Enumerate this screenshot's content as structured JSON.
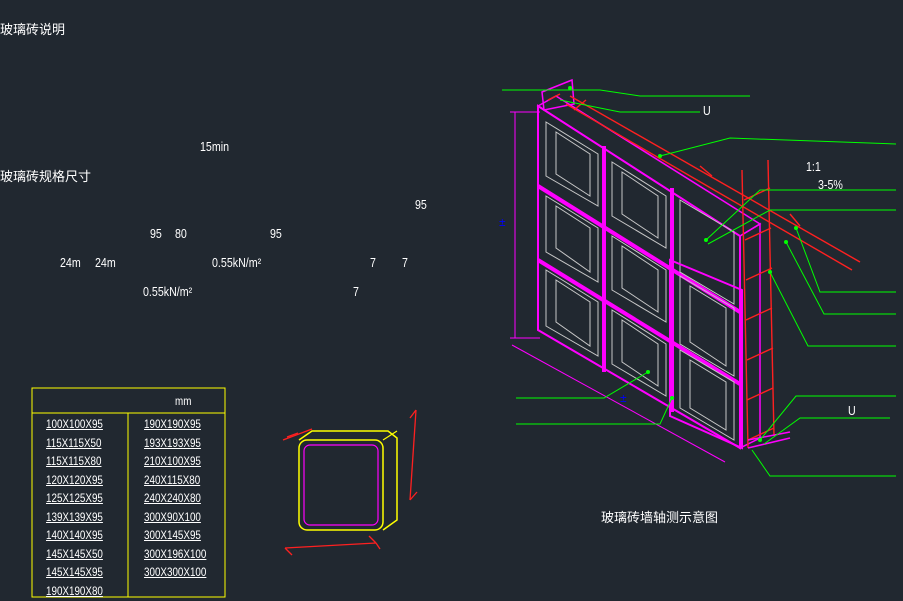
{
  "notes": {
    "heading1": "玻璃砖说明",
    "duration": "15min",
    "heading2": "玻璃砖规格尺寸",
    "n95_a": "95",
    "n95_b": "95",
    "n80": "80",
    "n95_c": "95",
    "dim24a": "24m",
    "dim24b": "24m",
    "load1": "0.55kN/m²",
    "n7_a": "7",
    "n7_b": "7",
    "load2": "0.55kN/m²",
    "n7_c": "7"
  },
  "spec_table": {
    "unit": "mm",
    "left_col": [
      "100X100X95",
      "115X115X50",
      "115X115X80",
      "120X120X95",
      "125X125X95",
      "139X139X95",
      "140X140X95",
      "145X145X50",
      "145X145X95",
      "190X190X80"
    ],
    "right_col": [
      "190X190X95",
      "193X193X95",
      "210X100X95",
      "240X115X80",
      "240X240X80",
      "300X90X100",
      "300X145X95",
      "300X196X100",
      "300X300X100",
      ""
    ]
  },
  "axon_labels": {
    "u_top": "U",
    "slope1": "1:1",
    "slope2": "3-5%",
    "u_bottom": "U",
    "caption": "玻璃砖墙轴测示意图"
  },
  "colors": {
    "background": "#212830",
    "magenta": "#ff00ff",
    "green": "#00ff00",
    "red": "#ff2020",
    "yellow": "#ffff00",
    "blue": "#0000ff",
    "gray": "#c8c8c8"
  }
}
